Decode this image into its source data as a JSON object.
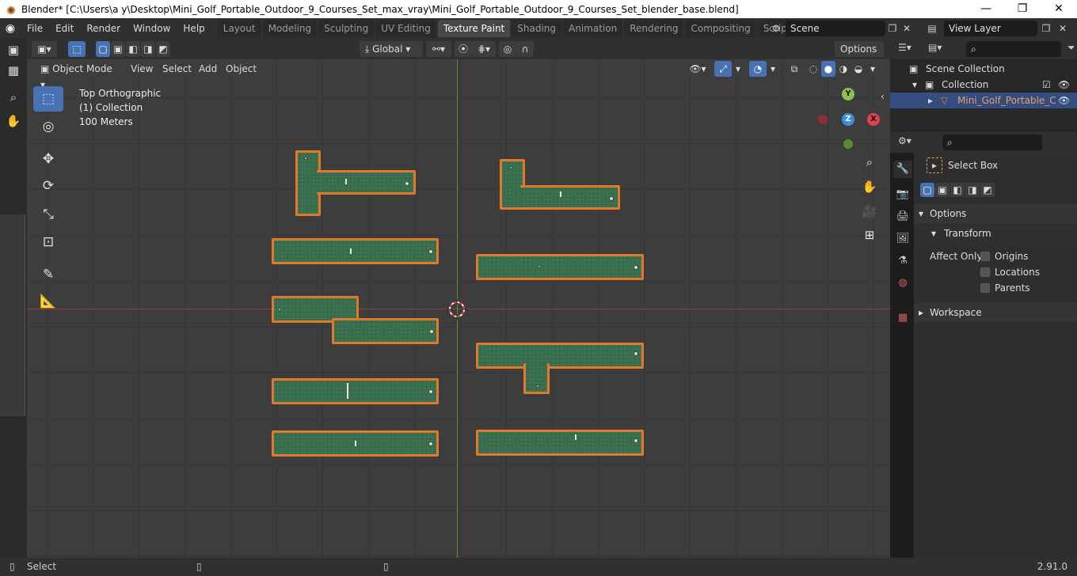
{
  "window": {
    "title": "Blender* [C:\\Users\\a y\\Desktop\\Mini_Golf_Portable_Outdoor_9_Courses_Set_max_vray\\Mini_Golf_Portable_Outdoor_9_Courses_Set_blender_base.blend]",
    "minimize": "—",
    "maximize": "❐",
    "close": "✕"
  },
  "menu": [
    "File",
    "Edit",
    "Render",
    "Window",
    "Help"
  ],
  "workspaces": [
    {
      "label": "Layout",
      "active": false
    },
    {
      "label": "Modeling",
      "active": false
    },
    {
      "label": "Sculpting",
      "active": false
    },
    {
      "label": "UV Editing",
      "active": false
    },
    {
      "label": "Texture Paint",
      "active": true
    },
    {
      "label": "Shading",
      "active": false
    },
    {
      "label": "Animation",
      "active": false
    },
    {
      "label": "Rendering",
      "active": false
    },
    {
      "label": "Compositing",
      "active": false
    },
    {
      "label": "Scripting",
      "active": false
    }
  ],
  "add_workspace": "+",
  "scene": {
    "name": "Scene"
  },
  "view_layer": {
    "name": "View Layer"
  },
  "viewport": {
    "transform_orientation": "Global",
    "options_label": "Options",
    "mode": "Object Mode",
    "header_menus": [
      "View",
      "Select",
      "Add",
      "Object"
    ],
    "overlay_text": {
      "view": "Top Orthographic",
      "collection": "(1) Collection",
      "scale": "100 Meters"
    },
    "gizmo": {
      "y": "Y",
      "z": "Z",
      "x": "X"
    }
  },
  "outliner": {
    "scene_collection": "Scene Collection",
    "collection": "Collection",
    "object": "Mini_Golf_Portable_C"
  },
  "properties": {
    "tool_name": "Select Box",
    "options_section": "Options",
    "transform_section": "Transform",
    "affect_only": "Affect Only",
    "checkboxes": [
      {
        "label": "Origins",
        "checked": false
      },
      {
        "label": "Locations",
        "checked": false
      },
      {
        "label": "Parents",
        "checked": false
      }
    ],
    "workspace_section": "Workspace"
  },
  "status": {
    "left": "Select",
    "version": "2.91.0"
  },
  "colors": {
    "accent": "#4772b3",
    "selection_outline": "#e07a2a",
    "turf": "#3b7050",
    "x_axis": "#a0393a",
    "y_axis": "#5b8d3a"
  }
}
